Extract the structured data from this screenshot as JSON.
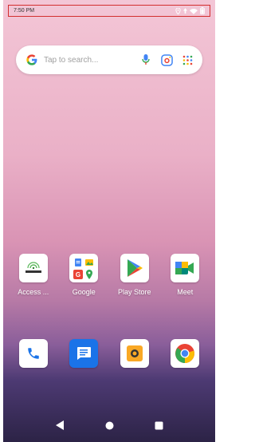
{
  "status_bar": {
    "time": "7:50 PM"
  },
  "search": {
    "placeholder": "Tap to search..."
  },
  "home_apps": [
    {
      "label": "Access ..."
    },
    {
      "label": "Google"
    },
    {
      "label": "Play Store"
    },
    {
      "label": "Meet"
    }
  ],
  "dock_apps": [
    {
      "name": "Phone"
    },
    {
      "name": "Messages"
    },
    {
      "name": "Camera"
    },
    {
      "name": "Chrome"
    }
  ],
  "icons": {
    "location": "location-icon",
    "wifi": "wifi-icon",
    "battery": "battery-icon",
    "mic": "mic-icon",
    "lens": "lens-icon",
    "apps_grid": "apps-grid-icon"
  },
  "colors": {
    "accent_blue": "#1a73e8",
    "status_border": "#d32f2f"
  }
}
